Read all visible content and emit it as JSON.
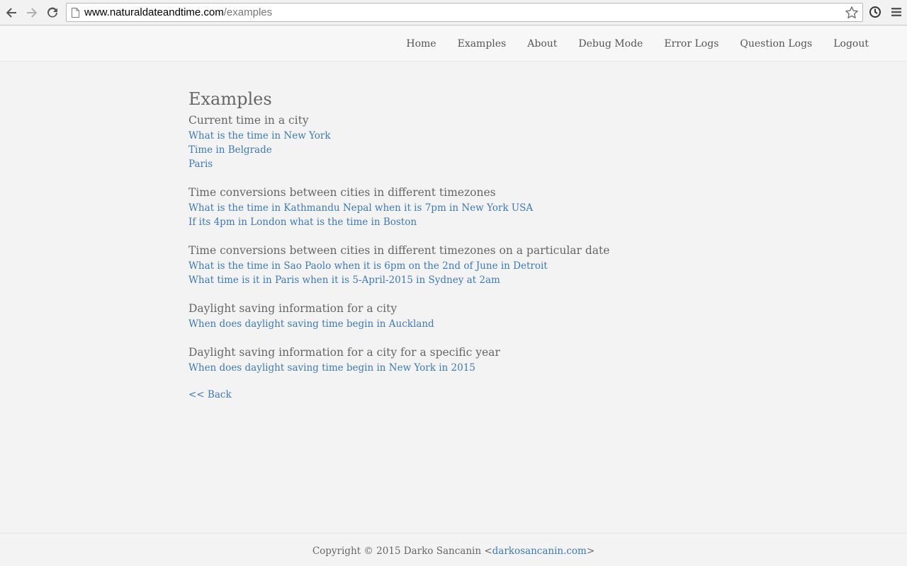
{
  "browser": {
    "url_domain": "www.naturaldateandtime.com",
    "url_path": "/examples",
    "icons": [
      "back-icon",
      "forward-icon",
      "reload-icon",
      "page-icon",
      "star-icon",
      "history-icon",
      "menu-icon"
    ]
  },
  "nav": {
    "items": [
      {
        "label": "Home"
      },
      {
        "label": "Examples"
      },
      {
        "label": "About"
      },
      {
        "label": "Debug Mode"
      },
      {
        "label": "Error Logs"
      },
      {
        "label": "Question Logs"
      },
      {
        "label": "Logout"
      }
    ]
  },
  "main": {
    "title": "Examples",
    "sections": [
      {
        "heading": "Current time in a city",
        "links": [
          "What is the time in New York",
          "Time in Belgrade",
          "Paris"
        ]
      },
      {
        "heading": "Time conversions between cities in different timezones",
        "links": [
          "What is the time in Kathmandu Nepal when it is 7pm in New York USA",
          "If its 4pm in London what is the time in Boston"
        ]
      },
      {
        "heading": "Time conversions between cities in different timezones on a particular date",
        "links": [
          "What is the time in Sao Paolo when it is 6pm on the 2nd of June in Detroit",
          "What time is it in Paris when it is 5-April-2015 in Sydney at 2am"
        ]
      },
      {
        "heading": "Daylight saving information for a city",
        "links": [
          "When does daylight saving time begin in Auckland"
        ]
      },
      {
        "heading": "Daylight saving information for a city for a specific year",
        "links": [
          "When does daylight saving time begin in New York in 2015"
        ]
      }
    ],
    "back_label": "<< Back"
  },
  "footer": {
    "text_before": "Copyright © 2015 Darko Sancanin <",
    "link": "darkosancanin.com",
    "text_after": ">"
  },
  "colors": {
    "link": "#3d79b5",
    "text": "#666666",
    "background": "#f3f3f3"
  }
}
